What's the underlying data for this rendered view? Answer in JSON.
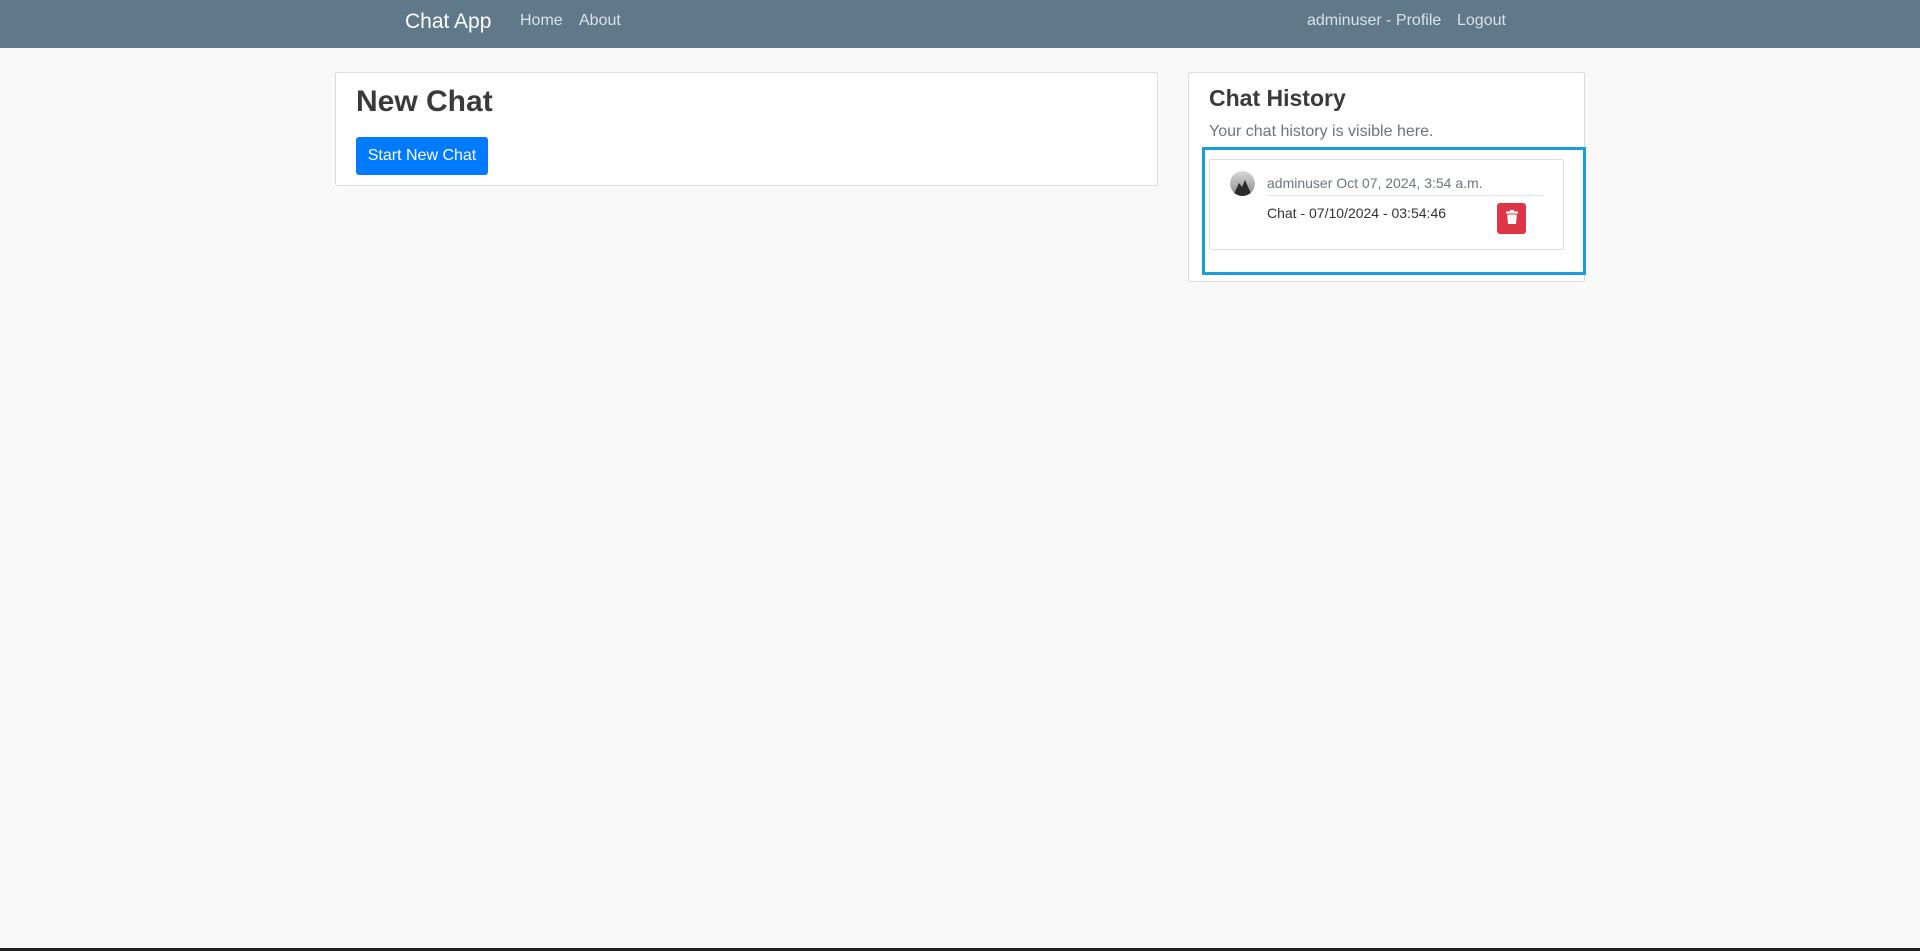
{
  "navbar": {
    "brand": "Chat App",
    "links": {
      "home": "Home",
      "about": "About"
    },
    "user": {
      "profile": "adminuser - Profile",
      "logout": "Logout"
    }
  },
  "new_chat": {
    "title": "New Chat",
    "start_button": "Start New Chat"
  },
  "history": {
    "title": "Chat History",
    "subtitle": "Your chat history is visible here.",
    "items": [
      {
        "meta": "adminuser Oct 07, 2024, 3:54 a.m.",
        "name": "Chat - 07/10/2024 - 03:54:46",
        "avatar_icon": "avatar-icon",
        "delete_icon": "trash-icon"
      }
    ]
  },
  "colors": {
    "navbar": "#5f788a",
    "primary": "#007bff",
    "danger": "#dc3545",
    "highlight": "#1a9edb",
    "background": "#f9f9f9"
  }
}
